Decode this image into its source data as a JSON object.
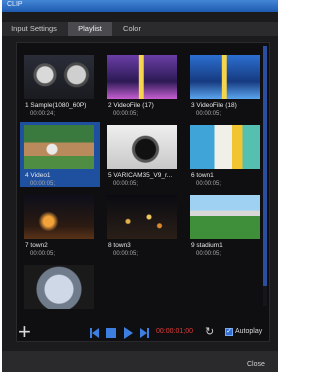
{
  "window": {
    "title": "CLIP"
  },
  "tabs": [
    {
      "label": "Input Settings",
      "active": false
    },
    {
      "label": "Playlist",
      "active": true
    },
    {
      "label": "Color",
      "active": false
    }
  ],
  "clips": [
    {
      "label": "1 Sample(1080_60P)",
      "duration": "00:00:24;",
      "selected": false,
      "thumb": "watch-dials"
    },
    {
      "label": "2 VideoFile (17)",
      "duration": "00:00:05;",
      "selected": false,
      "thumb": "purple-stage"
    },
    {
      "label": "3 VideoFile (18)",
      "duration": "00:00:05;",
      "selected": false,
      "thumb": "blue-stage"
    },
    {
      "label": "4 Video1",
      "duration": "00:00:05;",
      "selected": true,
      "thumb": "baseball"
    },
    {
      "label": "5 VARICAM35_V9_r...",
      "duration": "00:00:05;",
      "selected": false,
      "thumb": "camera-gear"
    },
    {
      "label": "6 town1",
      "duration": "00:00:05;",
      "selected": false,
      "thumb": "colorful-street"
    },
    {
      "label": "7 town2",
      "duration": "00:00:05;",
      "selected": false,
      "thumb": "night-town"
    },
    {
      "label": "8 town3",
      "duration": "00:00:05;",
      "selected": false,
      "thumb": "city-lights"
    },
    {
      "label": "9 stadium1",
      "duration": "00:00:05;",
      "selected": false,
      "thumb": "stadium"
    },
    {
      "label": "",
      "duration": "",
      "selected": false,
      "thumb": "fisheye-street"
    }
  ],
  "controls": {
    "add_label": "+",
    "timecode": "00:00:01;00",
    "autoplay_label": "Autoplay",
    "autoplay_checked": true
  },
  "footer": {
    "close_label": "Close"
  }
}
